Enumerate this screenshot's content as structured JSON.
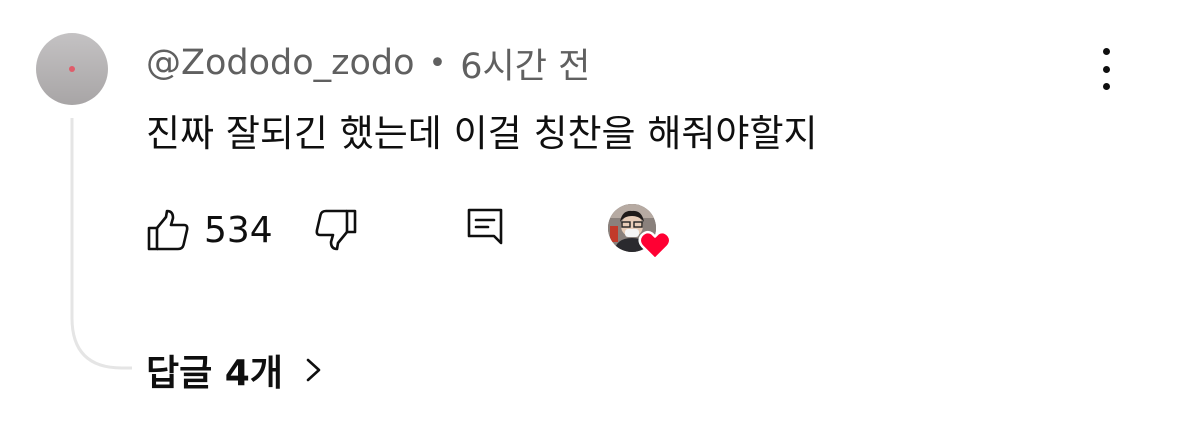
{
  "comment": {
    "author": "@Zododo_zodo",
    "separator": "•",
    "time_ago": "6시간 전",
    "text": "진짜 잘되긴 했는데 이걸 칭찬을 해줘야할지",
    "like_count": "534"
  },
  "actions": {
    "like_icon": "thumb-up-icon",
    "dislike_icon": "thumb-down-icon",
    "reply_icon": "comment-reply-icon",
    "more_icon": "more-vertical-icon"
  },
  "creator_heart": {
    "icon": "heart-icon",
    "color": "#ff0033"
  },
  "replies": {
    "label": "답글 4개",
    "icon": "chevron-right-icon"
  }
}
